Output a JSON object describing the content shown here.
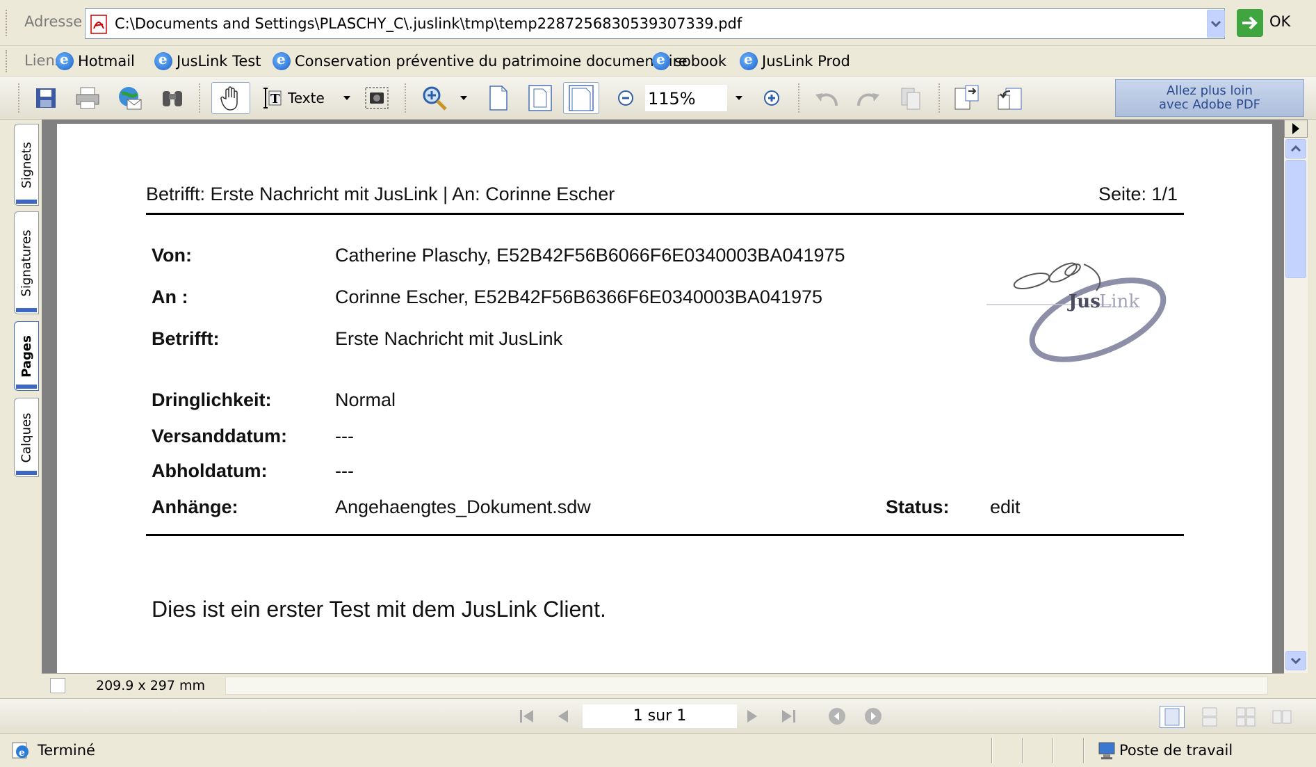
{
  "address_bar": {
    "label": "Adresse",
    "url": "C:\\Documents and Settings\\PLASCHY_C\\.juslink\\tmp\\temp2287256830539307339.pdf",
    "go_label": "OK"
  },
  "links_bar": {
    "label": "Liens",
    "items": [
      {
        "label": "Hotmail"
      },
      {
        "label": "JusLink Test"
      },
      {
        "label": "Conservation préventive du patrimoine documentaire"
      },
      {
        "label": "sobook"
      },
      {
        "label": "JusLink Prod"
      }
    ]
  },
  "toolbar": {
    "select_text_label": "Texte",
    "zoom_value": "115%",
    "adobe_banner_line1": "Allez plus loin",
    "adobe_banner_line2": "avec Adobe PDF"
  },
  "side_tabs": [
    {
      "label": "Signets"
    },
    {
      "label": "Signatures"
    },
    {
      "label": "Pages"
    },
    {
      "label": "Calques"
    }
  ],
  "document": {
    "header_subject": "Betrifft:  Erste Nachricht mit JusLink   |  An: Corinne  Escher",
    "header_page": "Seite: 1/1",
    "fields": [
      {
        "label": "Von:",
        "value": "Catherine  Plaschy,  E52B42F56B6066F6E0340003BA041975"
      },
      {
        "label": "An :",
        "value": "Corinne  Escher,  E52B42F56B6366F6E0340003BA041975"
      },
      {
        "label": "Betrifft:",
        "value": "Erste Nachricht mit JusLink"
      },
      {
        "label": "Dringlichkeit:",
        "value": "Normal"
      },
      {
        "label": "Versanddatum:",
        "value": "---"
      },
      {
        "label": "Abholdatum:",
        "value": "---"
      },
      {
        "label": "Anhänge:",
        "value": "Angehaengtes_Dokument.sdw"
      }
    ],
    "status_label": "Status:",
    "status_value": "edit",
    "body_text": "Dies ist ein erster Test mit dem JusLink Client.",
    "logo_text_jus": "Jus",
    "logo_text_link": "Link"
  },
  "page_size": "209.9 x 297 mm",
  "navigation": {
    "page_display": "1 sur 1"
  },
  "status_bar": {
    "status": "Terminé",
    "zone": "Poste de travail"
  }
}
